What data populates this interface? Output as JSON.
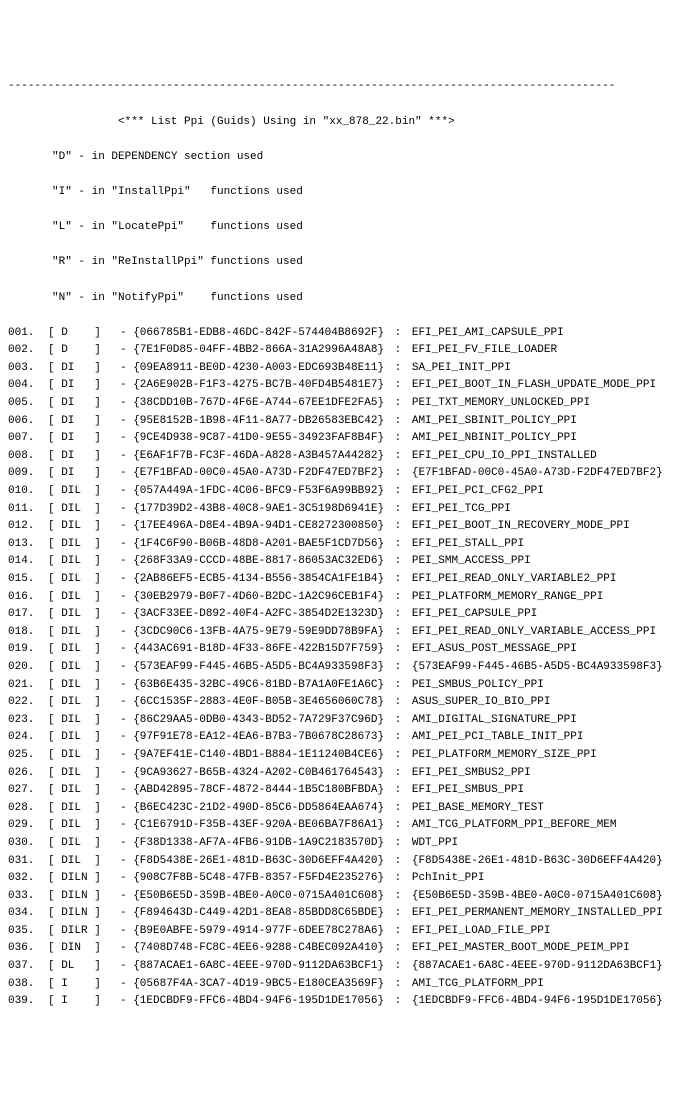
{
  "separator": "--------------------------------------------------------------------------------------------",
  "title": "<*** List Ppi (Guids) Using in \"xx_878_22.bin\" ***>",
  "legend": {
    "d": "\"D\" - in DEPENDENCY section used",
    "i": "\"I\" - in \"InstallPpi\"   functions used",
    "l": "\"L\" - in \"LocatePpi\"    functions used",
    "r": "\"R\" - in \"ReInstallPpi\" functions used",
    "n": "\"N\" - in \"NotifyPpi\"    functions used"
  },
  "rows": [
    {
      "num": "001.",
      "flag": "[ D    ]",
      "guid": "- {066785B1-EDB8-46DC-842F-574404B8692F}",
      "name": "EFI_PEI_AMI_CAPSULE_PPI"
    },
    {
      "num": "002.",
      "flag": "[ D    ]",
      "guid": "- {7E1F0D85-04FF-4BB2-866A-31A2996A48A8}",
      "name": "EFI_PEI_FV_FILE_LOADER"
    },
    {
      "num": "003.",
      "flag": "[ DI   ]",
      "guid": "- {09EA8911-BE0D-4230-A003-EDC693B48E11}",
      "name": "SA_PEI_INIT_PPI"
    },
    {
      "num": "004.",
      "flag": "[ DI   ]",
      "guid": "- {2A6E902B-F1F3-4275-BC7B-40FD4B5481E7}",
      "name": "EFI_PEI_BOOT_IN_FLASH_UPDATE_MODE_PPI"
    },
    {
      "num": "005.",
      "flag": "[ DI   ]",
      "guid": "- {38CDD10B-767D-4F6E-A744-67EE1DFE2FA5}",
      "name": "PEI_TXT_MEMORY_UNLOCKED_PPI"
    },
    {
      "num": "006.",
      "flag": "[ DI   ]",
      "guid": "- {95E8152B-1B98-4F11-8A77-DB26583EBC42}",
      "name": "AMI_PEI_SBINIT_POLICY_PPI"
    },
    {
      "num": "007.",
      "flag": "[ DI   ]",
      "guid": "- {9CE4D938-9C87-41D0-9E55-34923FAF8B4F}",
      "name": "AMI_PEI_NBINIT_POLICY_PPI"
    },
    {
      "num": "008.",
      "flag": "[ DI   ]",
      "guid": "- {E6AF1F7B-FC3F-46DA-A828-A3B457A44282}",
      "name": "EFI_PEI_CPU_IO_PPI_INSTALLED"
    },
    {
      "num": "009.",
      "flag": "[ DI   ]",
      "guid": "- {E7F1BFAD-00C0-45A0-A73D-F2DF47ED7BF2}",
      "name": "{E7F1BFAD-00C0-45A0-A73D-F2DF47ED7BF2}"
    },
    {
      "num": "010.",
      "flag": "[ DIL  ]",
      "guid": "- {057A449A-1FDC-4C06-BFC9-F53F6A99BB92}",
      "name": "EFI_PEI_PCI_CFG2_PPI"
    },
    {
      "num": "011.",
      "flag": "[ DIL  ]",
      "guid": "- {177D39D2-43B8-40C8-9AE1-3C5198D6941E}",
      "name": "EFI_PEI_TCG_PPI"
    },
    {
      "num": "012.",
      "flag": "[ DIL  ]",
      "guid": "- {17EE496A-D8E4-4B9A-94D1-CE8272300850}",
      "name": "EFI_PEI_BOOT_IN_RECOVERY_MODE_PPI"
    },
    {
      "num": "013.",
      "flag": "[ DIL  ]",
      "guid": "- {1F4C6F90-B06B-48D8-A201-BAE5F1CD7D56}",
      "name": "EFI_PEI_STALL_PPI"
    },
    {
      "num": "014.",
      "flag": "[ DIL  ]",
      "guid": "- {268F33A9-CCCD-48BE-8817-86053AC32ED6}",
      "name": "PEI_SMM_ACCESS_PPI"
    },
    {
      "num": "015.",
      "flag": "[ DIL  ]",
      "guid": "- {2AB86EF5-ECB5-4134-B556-3854CA1FE1B4}",
      "name": "EFI_PEI_READ_ONLY_VARIABLE2_PPI"
    },
    {
      "num": "016.",
      "flag": "[ DIL  ]",
      "guid": "- {30EB2979-B0F7-4D60-B2DC-1A2C96CEB1F4}",
      "name": "PEI_PLATFORM_MEMORY_RANGE_PPI"
    },
    {
      "num": "017.",
      "flag": "[ DIL  ]",
      "guid": "- {3ACF33EE-D892-40F4-A2FC-3854D2E1323D}",
      "name": "EFI_PEI_CAPSULE_PPI"
    },
    {
      "num": "018.",
      "flag": "[ DIL  ]",
      "guid": "- {3CDC90C6-13FB-4A75-9E79-59E9DD78B9FA}",
      "name": "EFI_PEI_READ_ONLY_VARIABLE_ACCESS_PPI"
    },
    {
      "num": "019.",
      "flag": "[ DIL  ]",
      "guid": "- {443AC691-B18D-4F33-86FE-422B15D7F759}",
      "name": "EFI_ASUS_POST_MESSAGE_PPI"
    },
    {
      "num": "020.",
      "flag": "[ DIL  ]",
      "guid": "- {573EAF99-F445-46B5-A5D5-BC4A933598F3}",
      "name": "{573EAF99-F445-46B5-A5D5-BC4A933598F3}"
    },
    {
      "num": "021.",
      "flag": "[ DIL  ]",
      "guid": "- {63B6E435-32BC-49C6-81BD-B7A1A0FE1A6C}",
      "name": "PEI_SMBUS_POLICY_PPI"
    },
    {
      "num": "022.",
      "flag": "[ DIL  ]",
      "guid": "- {6CC1535F-2883-4E0F-B05B-3E4656060C78}",
      "name": "ASUS_SUPER_IO_BIO_PPI"
    },
    {
      "num": "023.",
      "flag": "[ DIL  ]",
      "guid": "- {86C29AA5-0DB0-4343-BD52-7A729F37C96D}",
      "name": "AMI_DIGITAL_SIGNATURE_PPI"
    },
    {
      "num": "024.",
      "flag": "[ DIL  ]",
      "guid": "- {97F91E78-EA12-4EA6-B7B3-7B0678C28673}",
      "name": "AMI_PEI_PCI_TABLE_INIT_PPI"
    },
    {
      "num": "025.",
      "flag": "[ DIL  ]",
      "guid": "- {9A7EF41E-C140-4BD1-B884-1E11240B4CE6}",
      "name": "PEI_PLATFORM_MEMORY_SIZE_PPI"
    },
    {
      "num": "026.",
      "flag": "[ DIL  ]",
      "guid": "- {9CA93627-B65B-4324-A202-C0B461764543}",
      "name": "EFI_PEI_SMBUS2_PPI"
    },
    {
      "num": "027.",
      "flag": "[ DIL  ]",
      "guid": "- {ABD42895-78CF-4872-8444-1B5C180BFBDA}",
      "name": "EFI_PEI_SMBUS_PPI"
    },
    {
      "num": "028.",
      "flag": "[ DIL  ]",
      "guid": "- {B6EC423C-21D2-490D-85C6-DD5864EAA674}",
      "name": "PEI_BASE_MEMORY_TEST"
    },
    {
      "num": "029.",
      "flag": "[ DIL  ]",
      "guid": "- {C1E6791D-F35B-43EF-920A-BE06BA7F86A1}",
      "name": "AMI_TCG_PLATFORM_PPI_BEFORE_MEM"
    },
    {
      "num": "030.",
      "flag": "[ DIL  ]",
      "guid": "- {F38D1338-AF7A-4FB6-91DB-1A9C2183570D}",
      "name": "WDT_PPI"
    },
    {
      "num": "031.",
      "flag": "[ DIL  ]",
      "guid": "- {F8D5438E-26E1-481D-B63C-30D6EFF4A420}",
      "name": "{F8D5438E-26E1-481D-B63C-30D6EFF4A420}"
    },
    {
      "num": "032.",
      "flag": "[ DILN ]",
      "guid": "- {908C7F8B-5C48-47FB-8357-F5FD4E235276}",
      "name": "PchInit_PPI"
    },
    {
      "num": "033.",
      "flag": "[ DILN ]",
      "guid": "- {E50B6E5D-359B-4BE0-A0C0-0715A401C608}",
      "name": "{E50B6E5D-359B-4BE0-A0C0-0715A401C608}"
    },
    {
      "num": "034.",
      "flag": "[ DILN ]",
      "guid": "- {F894643D-C449-42D1-8EA8-85BDD8C65BDE}",
      "name": "EFI_PEI_PERMANENT_MEMORY_INSTALLED_PPI"
    },
    {
      "num": "035.",
      "flag": "[ DILR ]",
      "guid": "- {B9E0ABFE-5979-4914-977F-6DEE78C278A6}",
      "name": "EFI_PEI_LOAD_FILE_PPI"
    },
    {
      "num": "036.",
      "flag": "[ DIN  ]",
      "guid": "- {7408D748-FC8C-4EE6-9288-C4BEC092A410}",
      "name": "EFI_PEI_MASTER_BOOT_MODE_PEIM_PPI"
    },
    {
      "num": "037.",
      "flag": "[ DL   ]",
      "guid": "- {887ACAE1-6A8C-4EEE-970D-9112DA63BCF1}",
      "name": "{887ACAE1-6A8C-4EEE-970D-9112DA63BCF1}"
    },
    {
      "num": "038.",
      "flag": "[ I    ]",
      "guid": "- {05687F4A-3CA7-4D19-9BC5-E180CEA3569F}",
      "name": "AMI_TCG_PLATFORM_PPI"
    },
    {
      "num": "039.",
      "flag": "[ I    ]",
      "guid": "- {1EDCBDF9-FFC6-4BD4-94F6-195D1DE17056}",
      "name": "{1EDCBDF9-FFC6-4BD4-94F6-195D1DE17056}"
    }
  ]
}
